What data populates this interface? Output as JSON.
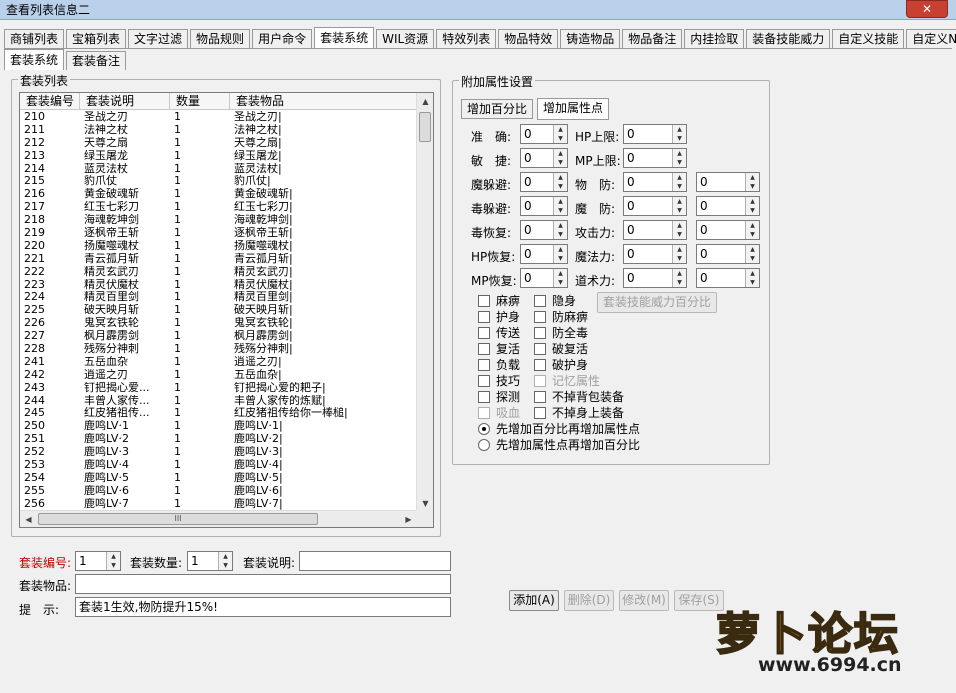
{
  "window": {
    "title": "查看列表信息二",
    "close_label": "✕"
  },
  "tabs": [
    "商铺列表",
    "宝箱列表",
    "文字过滤",
    "物品规则",
    "用户命令",
    "套装系统",
    "WIL资源",
    "特效列表",
    "物品特效",
    "铸造物品",
    "物品备注",
    "内挂捡取",
    "装备技能威力",
    "自定义技能",
    "自定义NPC"
  ],
  "subtabs": [
    "套装系统",
    "套装备注"
  ],
  "list_group": {
    "label": "套装列表"
  },
  "list": {
    "headers": [
      "套装编号",
      "套装说明",
      "数量",
      "套装物品"
    ],
    "rows": [
      [
        "210",
        "圣战之刃",
        "1",
        "圣战之刃|"
      ],
      [
        "211",
        "法神之杖",
        "1",
        "法神之杖|"
      ],
      [
        "212",
        "天尊之扇",
        "1",
        "天尊之扇|"
      ],
      [
        "213",
        "绿玉屠龙",
        "1",
        "绿玉屠龙|"
      ],
      [
        "214",
        "蓝灵法杖",
        "1",
        "蓝灵法杖|"
      ],
      [
        "215",
        "豹爪仗",
        "1",
        "豹爪仗|"
      ],
      [
        "216",
        "黄金破魂斩",
        "1",
        "黄金破魂斩|"
      ],
      [
        "217",
        "红玉七彩刀",
        "1",
        "红玉七彩刀|"
      ],
      [
        "218",
        "海魂乾坤剑",
        "1",
        "海魂乾坤剑|"
      ],
      [
        "219",
        "逐枫帝王斩",
        "1",
        "逐枫帝王斩|"
      ],
      [
        "220",
        "扬魔噬魂杖",
        "1",
        "扬魔噬魂杖|"
      ],
      [
        "221",
        "青云孤月斩",
        "1",
        "青云孤月斩|"
      ],
      [
        "222",
        "精灵玄武刃",
        "1",
        "精灵玄武刃|"
      ],
      [
        "223",
        "精灵伏魔杖",
        "1",
        "精灵伏魔杖|"
      ],
      [
        "224",
        "精灵百里剑",
        "1",
        "精灵百里剑|"
      ],
      [
        "225",
        "破天映月斩",
        "1",
        "破天映月斩|"
      ],
      [
        "226",
        "鬼冥玄铁轮",
        "1",
        "鬼冥玄铁轮|"
      ],
      [
        "227",
        "枫月霹雳剑",
        "1",
        "枫月霹雳剑|"
      ],
      [
        "228",
        "残殇分神刺",
        "1",
        "残殇分神刺|"
      ],
      [
        "241",
        "五岳血杂",
        "1",
        "逍遥之刃|"
      ],
      [
        "242",
        "逍遥之刃",
        "1",
        "五岳血杂|"
      ],
      [
        "243",
        "钉把揭心爱...",
        "1",
        "钉把揭心爱的耙子|"
      ],
      [
        "244",
        "丰曾人家传...",
        "1",
        "丰曾人家传的炼赋|"
      ],
      [
        "245",
        "红皮猪祖传...",
        "1",
        "红皮猪祖传给你一棒槌|"
      ],
      [
        "250",
        "鹿鸣LV·1",
        "1",
        "鹿鸣LV·1|"
      ],
      [
        "251",
        "鹿鸣LV·2",
        "1",
        "鹿鸣LV·2|"
      ],
      [
        "252",
        "鹿鸣LV·3",
        "1",
        "鹿鸣LV·3|"
      ],
      [
        "253",
        "鹿鸣LV·4",
        "1",
        "鹿鸣LV·4|"
      ],
      [
        "254",
        "鹿鸣LV·5",
        "1",
        "鹿鸣LV·5|"
      ],
      [
        "255",
        "鹿鸣LV·6",
        "1",
        "鹿鸣LV·6|"
      ],
      [
        "256",
        "鹿鸣LV·7",
        "1",
        "鹿鸣LV·7|"
      ]
    ],
    "hscroll_grip": "III"
  },
  "attr_group": {
    "label": "附加属性设置",
    "tabs": [
      "增加百分比",
      "增加属性点"
    ]
  },
  "attrs_left": [
    {
      "label": "准　确:",
      "value": "0"
    },
    {
      "label": "敏　捷:",
      "value": "0"
    },
    {
      "label": "魔躲避:",
      "value": "0"
    },
    {
      "label": "毒躲避:",
      "value": "0"
    },
    {
      "label": "毒恢复:",
      "value": "0"
    },
    {
      "label": "HP恢复:",
      "value": "0"
    },
    {
      "label": "MP恢复:",
      "value": "0"
    }
  ],
  "attrs_right": [
    {
      "label": "HP上限:",
      "value": "0",
      "value2": null
    },
    {
      "label": "MP上限:",
      "value": "0",
      "value2": null
    },
    {
      "label": "物　防:",
      "value": "0",
      "value2": "0"
    },
    {
      "label": "魔　防:",
      "value": "0",
      "value2": "0"
    },
    {
      "label": "攻击力:",
      "value": "0",
      "value2": "0"
    },
    {
      "label": "魔法力:",
      "value": "0",
      "value2": "0"
    },
    {
      "label": "道术力:",
      "value": "0",
      "value2": "0"
    }
  ],
  "checks_col1": [
    {
      "label": "麻痹",
      "disabled": false
    },
    {
      "label": "护身",
      "disabled": false
    },
    {
      "label": "传送",
      "disabled": false
    },
    {
      "label": "复活",
      "disabled": false
    },
    {
      "label": "负载",
      "disabled": false
    },
    {
      "label": "技巧",
      "disabled": false
    },
    {
      "label": "探测",
      "disabled": false
    },
    {
      "label": "吸血",
      "disabled": true
    }
  ],
  "checks_col2": [
    {
      "label": "隐身",
      "disabled": false
    },
    {
      "label": "防麻痹",
      "disabled": false
    },
    {
      "label": "防全毒",
      "disabled": false
    },
    {
      "label": "破复活",
      "disabled": false
    },
    {
      "label": "破护身",
      "disabled": false
    },
    {
      "label": "记忆属性",
      "disabled": true
    },
    {
      "label": "不掉背包装备",
      "disabled": false
    },
    {
      "label": "不掉身上装备",
      "disabled": false
    }
  ],
  "skill_power_button": "套装技能威力百分比",
  "radios": [
    {
      "label": "先增加百分比再增加属性点",
      "checked": true
    },
    {
      "label": "先增加属性点再增加百分比",
      "checked": false
    }
  ],
  "form": {
    "id_label": "套装编号:",
    "id_value": "1",
    "count_label": "套装数量:",
    "count_value": "1",
    "desc_label": "套装说明:",
    "desc_value": "",
    "items_label": "套装物品:",
    "items_value": "",
    "hint_label": "提　示:",
    "hint_value": "套装1生效,物防提升15%!"
  },
  "buttons": {
    "add": "添加(A)",
    "delete": "删除(D)",
    "edit": "修改(M)",
    "save": "保存(S)"
  },
  "watermark": {
    "name": "萝卜论坛",
    "url": "www.6994.cn"
  },
  "colors": {
    "accent_red": "#c00000",
    "title_bar": "#b9d1ea",
    "close_red": "#c84031"
  }
}
